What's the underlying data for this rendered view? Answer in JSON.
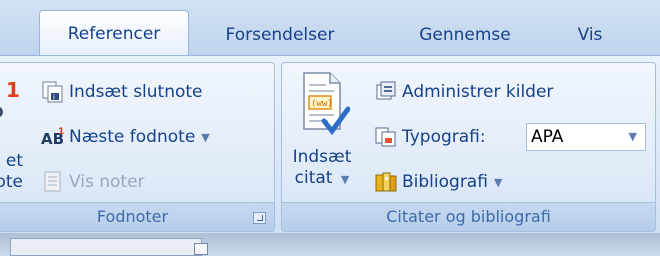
{
  "tabs": [
    "Referencer",
    "Forsendelser",
    "Gennemse",
    "Vis"
  ],
  "footnotes": {
    "partial_number": "1",
    "partial_big_label_lines": [
      "et",
      "ote"
    ],
    "insert_endnote": "Indsæt slutnote",
    "next_footnote": "Næste fodnote",
    "show_notes": "Vis noter",
    "group_label": "Fodnoter"
  },
  "citations": {
    "insert_citation_lines": [
      "Indsæt",
      "citat"
    ],
    "manage_sources": "Administrer kilder",
    "style_label": "Typografi:",
    "style_value": "APA",
    "bibliography": "Bibliografi",
    "group_label": "Citater og bibliografi"
  },
  "icons": {
    "insert_endnote": "endnote-icon",
    "next_footnote": "next-footnote-icon",
    "show_notes": "show-notes-icon",
    "insert_citation": "insert-citation-icon",
    "manage_sources": "manage-sources-icon",
    "style": "style-icon",
    "bibliography": "bibliography-icon",
    "launcher": "dialog-launcher-icon"
  },
  "colors": {
    "text": "#15428b",
    "disabled_text": "#97a8bf",
    "accent_red": "#d9401a"
  }
}
